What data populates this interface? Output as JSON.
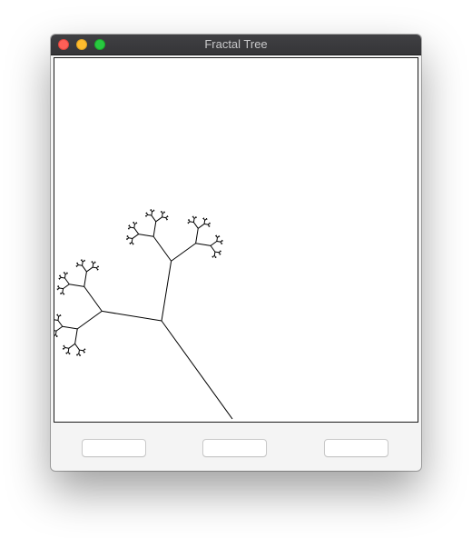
{
  "window": {
    "title": "Fractal Tree"
  },
  "controls": {
    "button_1_label": "",
    "button_2_label": "",
    "button_3_label": ""
  },
  "colors": {
    "titlebar": "#3a3a3d",
    "close": "#fe5f57",
    "minimize": "#febc2e",
    "maximize": "#28c840",
    "branch_stroke": "#000000",
    "canvas_background": "#ffffff"
  }
}
